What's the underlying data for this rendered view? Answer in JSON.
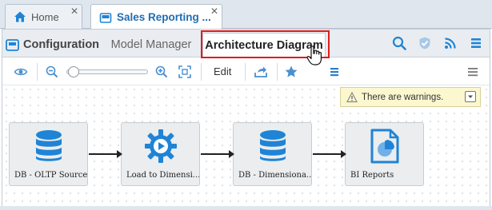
{
  "tabs": [
    {
      "label": "Home",
      "icon": "home-icon"
    },
    {
      "label": "Sales Reporting ...",
      "icon": "folder-tab-icon"
    }
  ],
  "subtabs": {
    "configuration": "Configuration",
    "model_manager": "Model Manager",
    "architecture": "Architecture Diagram"
  },
  "header_tools": [
    "search-icon",
    "check-shield-icon",
    "rss-icon",
    "menu-icon"
  ],
  "toolbar": {
    "edit_label": "Edit",
    "zoom_level": 0
  },
  "warning": {
    "text": "There are warnings."
  },
  "nodes": [
    {
      "label": "DB - OLTP Source",
      "icon": "database-icon"
    },
    {
      "label": "Load to Dimensi...",
      "icon": "etl-gear-icon"
    },
    {
      "label": "DB - Dimensiona...",
      "icon": "database-icon"
    },
    {
      "label": "BI Reports",
      "icon": "report-chart-icon"
    }
  ],
  "colors": {
    "accent": "#1f84d6",
    "highlight": "#e01b1b",
    "tab_text": "#1f6db5"
  }
}
